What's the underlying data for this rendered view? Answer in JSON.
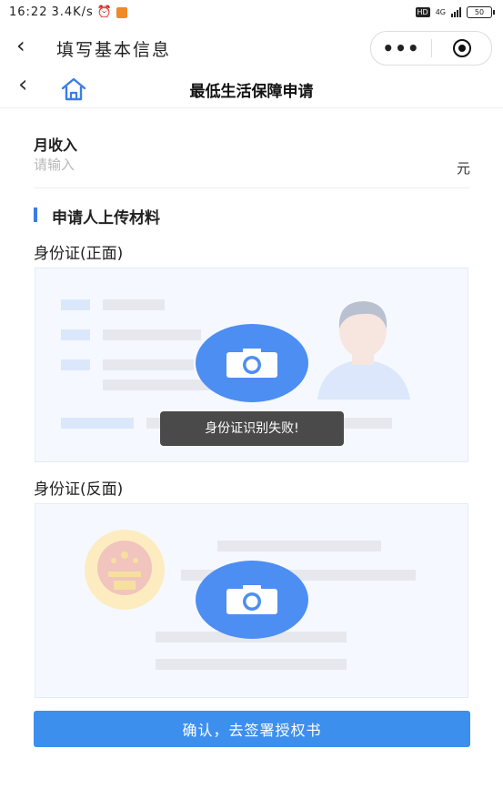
{
  "status_bar": {
    "time": "16:22",
    "speed": "3.4K/s",
    "hd": "HD",
    "net": "4G",
    "battery": "50"
  },
  "wechat_nav": {
    "back_icon": "chevron-left-icon",
    "title": "填写基本信息",
    "more": "•••",
    "close_icon": "target-icon"
  },
  "header": {
    "back_icon": "chevron-left-icon",
    "home_icon": "home-icon",
    "title": "最低生活保障申请"
  },
  "income": {
    "label": "月收入",
    "placeholder": "请输入",
    "value": "",
    "unit": "元"
  },
  "materials": {
    "title": "申请人上传材料",
    "id_front": {
      "label": "身份证(正面)",
      "icon": "camera-icon"
    },
    "id_back": {
      "label": "身份证(反面)",
      "icon": "camera-icon"
    }
  },
  "toast": {
    "text": "身份证识别失败!"
  },
  "confirm_button": {
    "label": "确认，去签署授权书"
  },
  "colors": {
    "accent": "#3d8fee",
    "camera": "#4d8ef2",
    "toast_bg": "#4a4a4a"
  }
}
